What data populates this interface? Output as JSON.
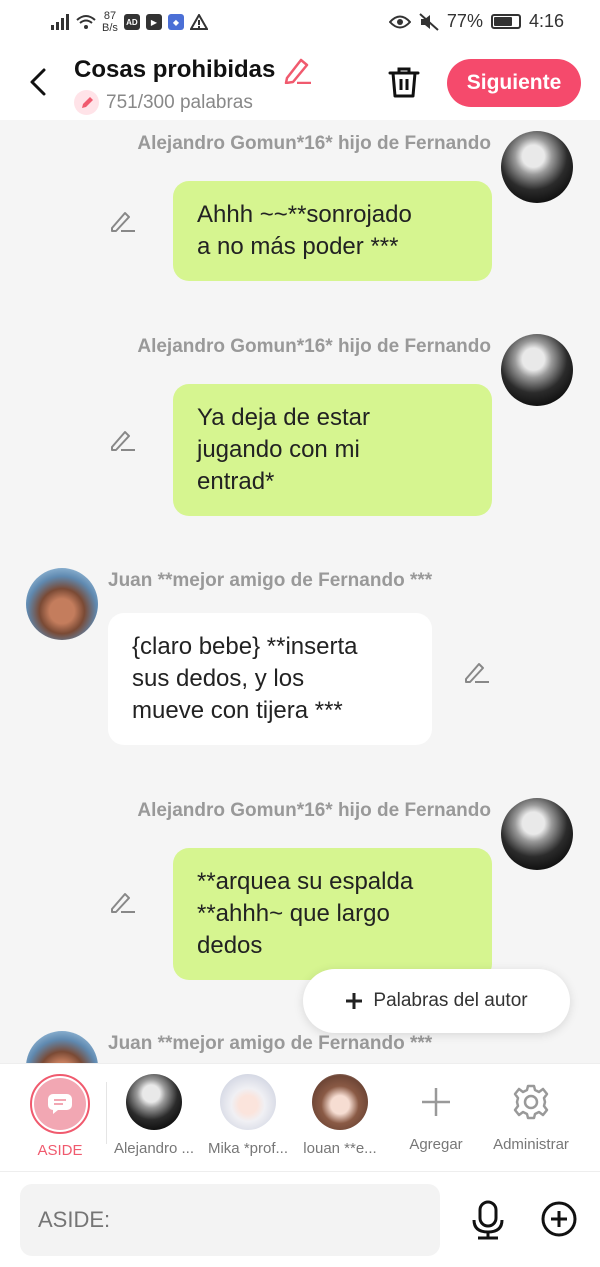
{
  "status_bar": {
    "speed_value": "87",
    "speed_unit": "B/s",
    "battery": "77%",
    "battery_level": 0.77,
    "time": "4:16"
  },
  "header": {
    "title": "Cosas prohibidas",
    "word_count": "751/300 palabras",
    "next_button": "Siguiente"
  },
  "messages": [
    {
      "speaker": "Alejandro Gomun*16* hijo de Fernando",
      "side": "right",
      "text_lines": [
        "Ahhh ~~**sonrojado",
        "a no más poder ***"
      ]
    },
    {
      "speaker": "Alejandro Gomun*16* hijo de Fernando",
      "side": "right",
      "text_lines": [
        "Ya deja de estar",
        "jugando con mi",
        "entrad*"
      ]
    },
    {
      "speaker": "Juan **mejor amigo de Fernando ***",
      "side": "left",
      "text_lines": [
        "{claro bebe} **inserta",
        "sus dedos, y los",
        "mueve con tijera ***"
      ]
    },
    {
      "speaker": "Alejandro Gomun*16* hijo de Fernando",
      "side": "right",
      "text_lines": [
        "**arquea su espalda",
        "**ahhh~ que largo",
        "dedos"
      ]
    },
    {
      "speaker": "Juan **mejor amigo de Fernando ***",
      "side": "left",
      "text_lines": []
    }
  ],
  "floating_button": "Palabras del autor",
  "characters": [
    {
      "label": "ASIDE",
      "selected": true
    },
    {
      "label": "Alejandro ..."
    },
    {
      "label": "Mika *prof..."
    },
    {
      "label": "louan **e..."
    },
    {
      "label": "Agregar"
    },
    {
      "label": "Administrar"
    }
  ],
  "input": {
    "placeholder": "ASIDE:"
  },
  "colors": {
    "accent": "#f54a6c",
    "my_bubble": "#d6f590",
    "other_bubble": "#ffffff",
    "aside": "#f05a6e"
  }
}
